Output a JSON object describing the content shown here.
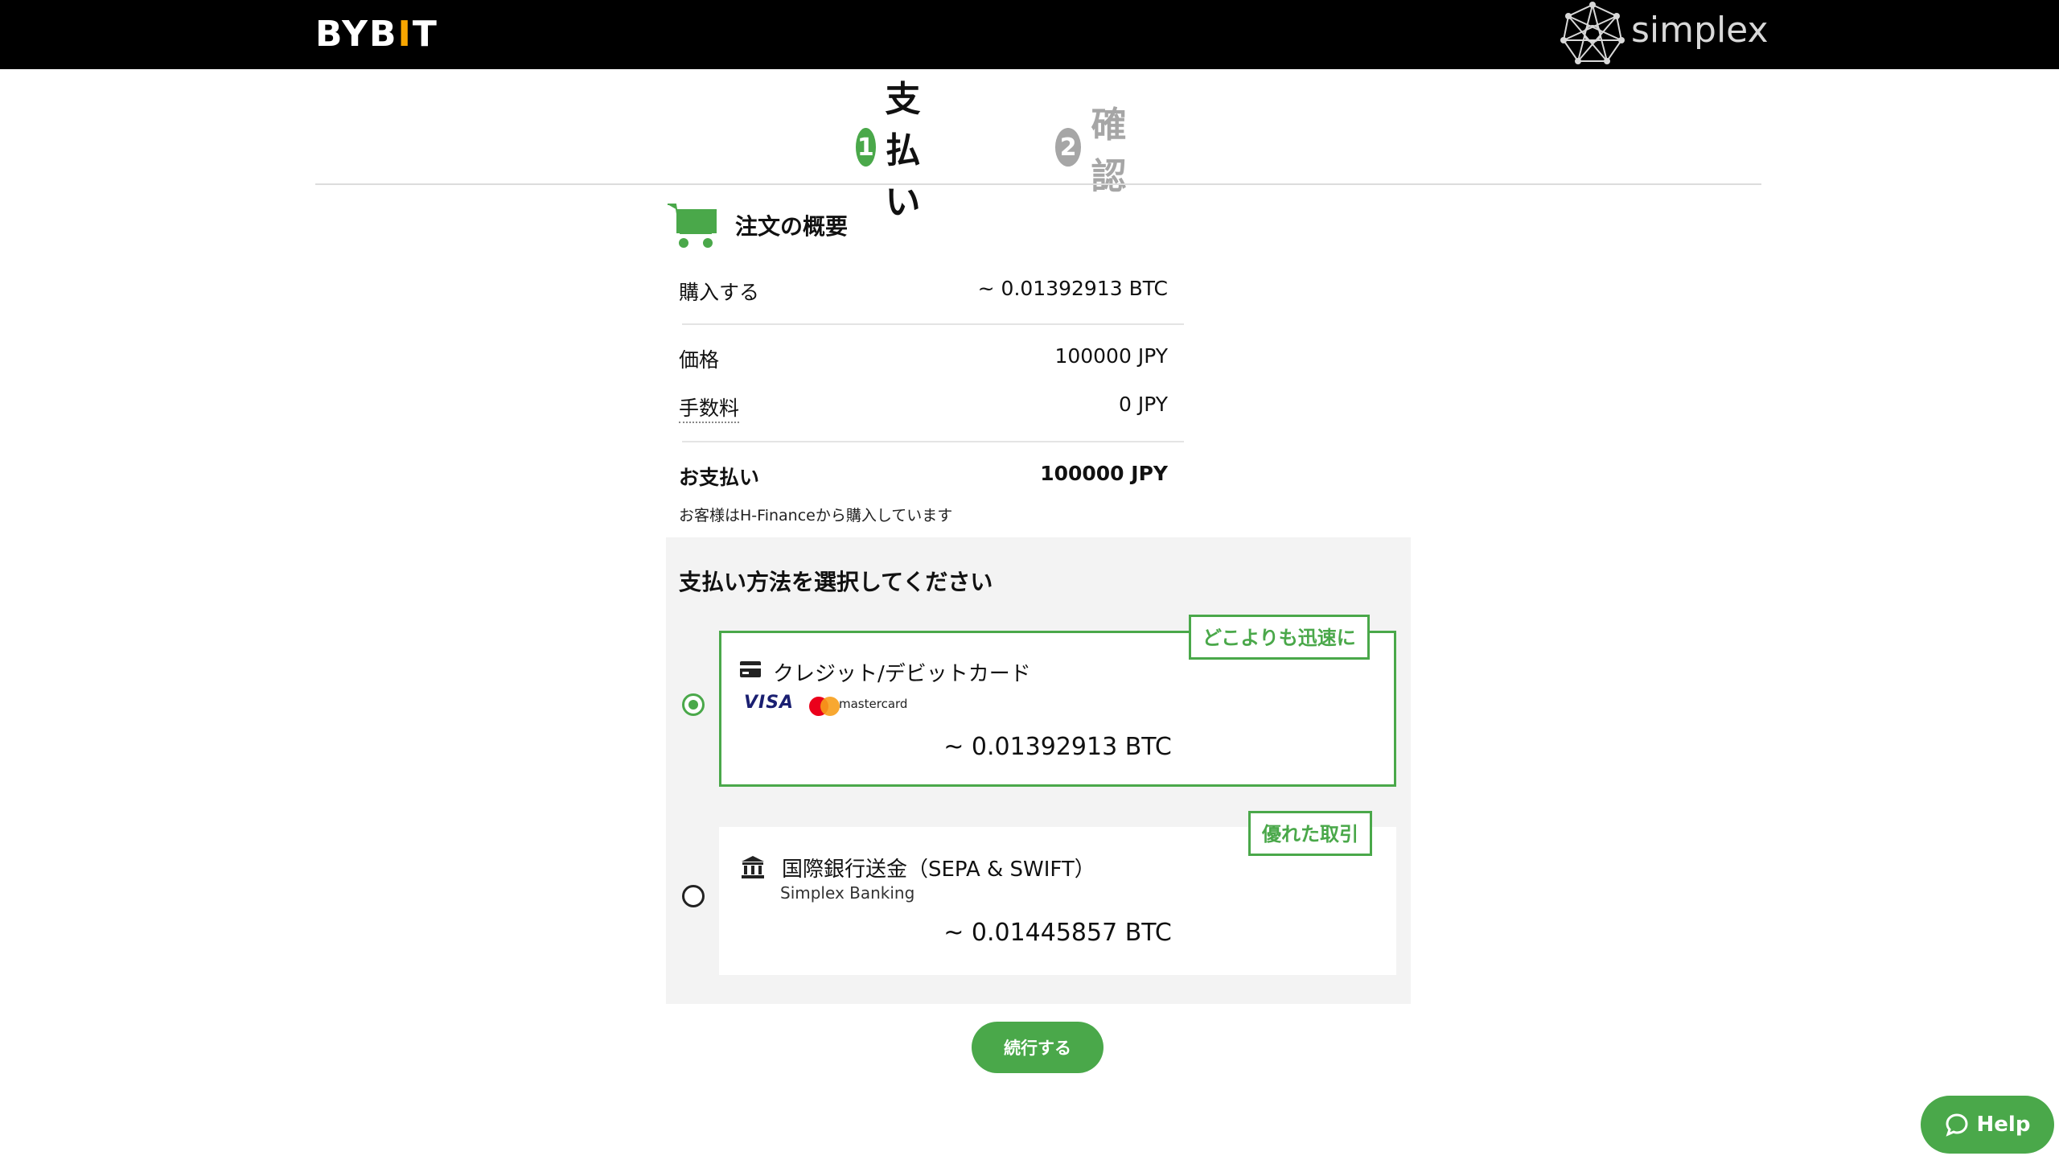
{
  "header": {
    "brand_left": "BYB",
    "brand_left_bar": "I",
    "brand_left_end": "T",
    "brand_right": "simplex"
  },
  "steps": [
    {
      "num": "1",
      "label": "支払い",
      "active": true
    },
    {
      "num": "2",
      "label": "確認",
      "active": false
    }
  ],
  "summary": {
    "title": "注文の概要",
    "buy_label": "購入する",
    "buy_value": "~ 0.01392913 BTC",
    "price_label": "価格",
    "price_value": "100000 JPY",
    "fee_label": "手数料",
    "fee_value": "0 JPY",
    "total_label": "お支払い",
    "total_value": "100000 JPY",
    "merchant_note": "お客様はH-Financeから購入しています"
  },
  "payment": {
    "title": "支払い方法を選択してください",
    "options": [
      {
        "name": "クレジット/デビットカード",
        "badge": "どこよりも迅速に",
        "brands": [
          "VISA",
          "mastercard"
        ],
        "amount": "~ 0.01392913 BTC",
        "selected": true
      },
      {
        "name": "国際銀行送金（SEPA & SWIFT）",
        "subtitle": "Simplex Banking",
        "badge": "優れた取引",
        "amount": "~ 0.01445857 BTC",
        "selected": false
      }
    ]
  },
  "continue_label": "続行する",
  "help_label": "Help",
  "colors": {
    "accent": "#4aa84a",
    "header_bg": "#000000",
    "inactive": "#a6a6a6"
  }
}
